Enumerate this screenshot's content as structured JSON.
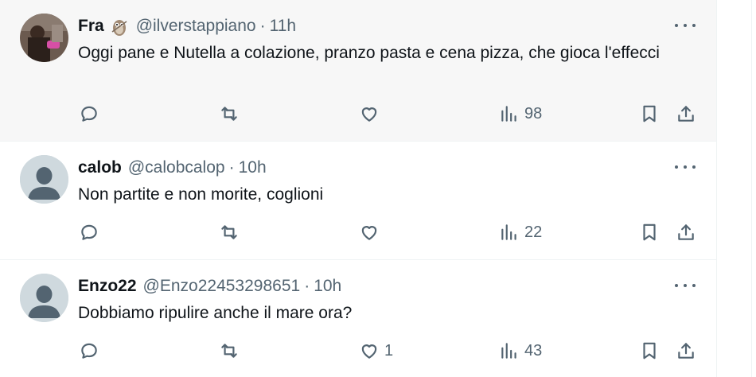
{
  "tweets": [
    {
      "name": "Fra",
      "handle": "@ilverstappiano",
      "separator": "·",
      "time": "11h",
      "text": "Oggi pane e Nutella a colazione, pranzo pasta e cena pizza, che gioca l'effecci",
      "replies": "",
      "reposts": "",
      "likes": "",
      "views": "98",
      "emoji": "owl-emoji"
    },
    {
      "name": "calob",
      "handle": "@calobcalop",
      "separator": "·",
      "time": "10h",
      "text": "Non partite e non morite, coglioni",
      "replies": "",
      "reposts": "",
      "likes": "",
      "views": "22"
    },
    {
      "name": "Enzo22",
      "handle": "@Enzo22453298651",
      "separator": "·",
      "time": "10h",
      "text": "Dobbiamo ripulire anche il mare ora?",
      "replies": "",
      "reposts": "",
      "likes": "1",
      "views": "43"
    }
  ],
  "icons": {
    "reply": "reply-icon",
    "repost": "repost-icon",
    "like": "heart-icon",
    "views": "views-icon",
    "bookmark": "bookmark-icon",
    "share": "share-icon",
    "more": "more-icon"
  },
  "colors": {
    "highlight_bg": "#f7f7f7",
    "secondary_text": "#536471",
    "primary_text": "#0f1419",
    "default_avatar": "#cfd9de"
  }
}
